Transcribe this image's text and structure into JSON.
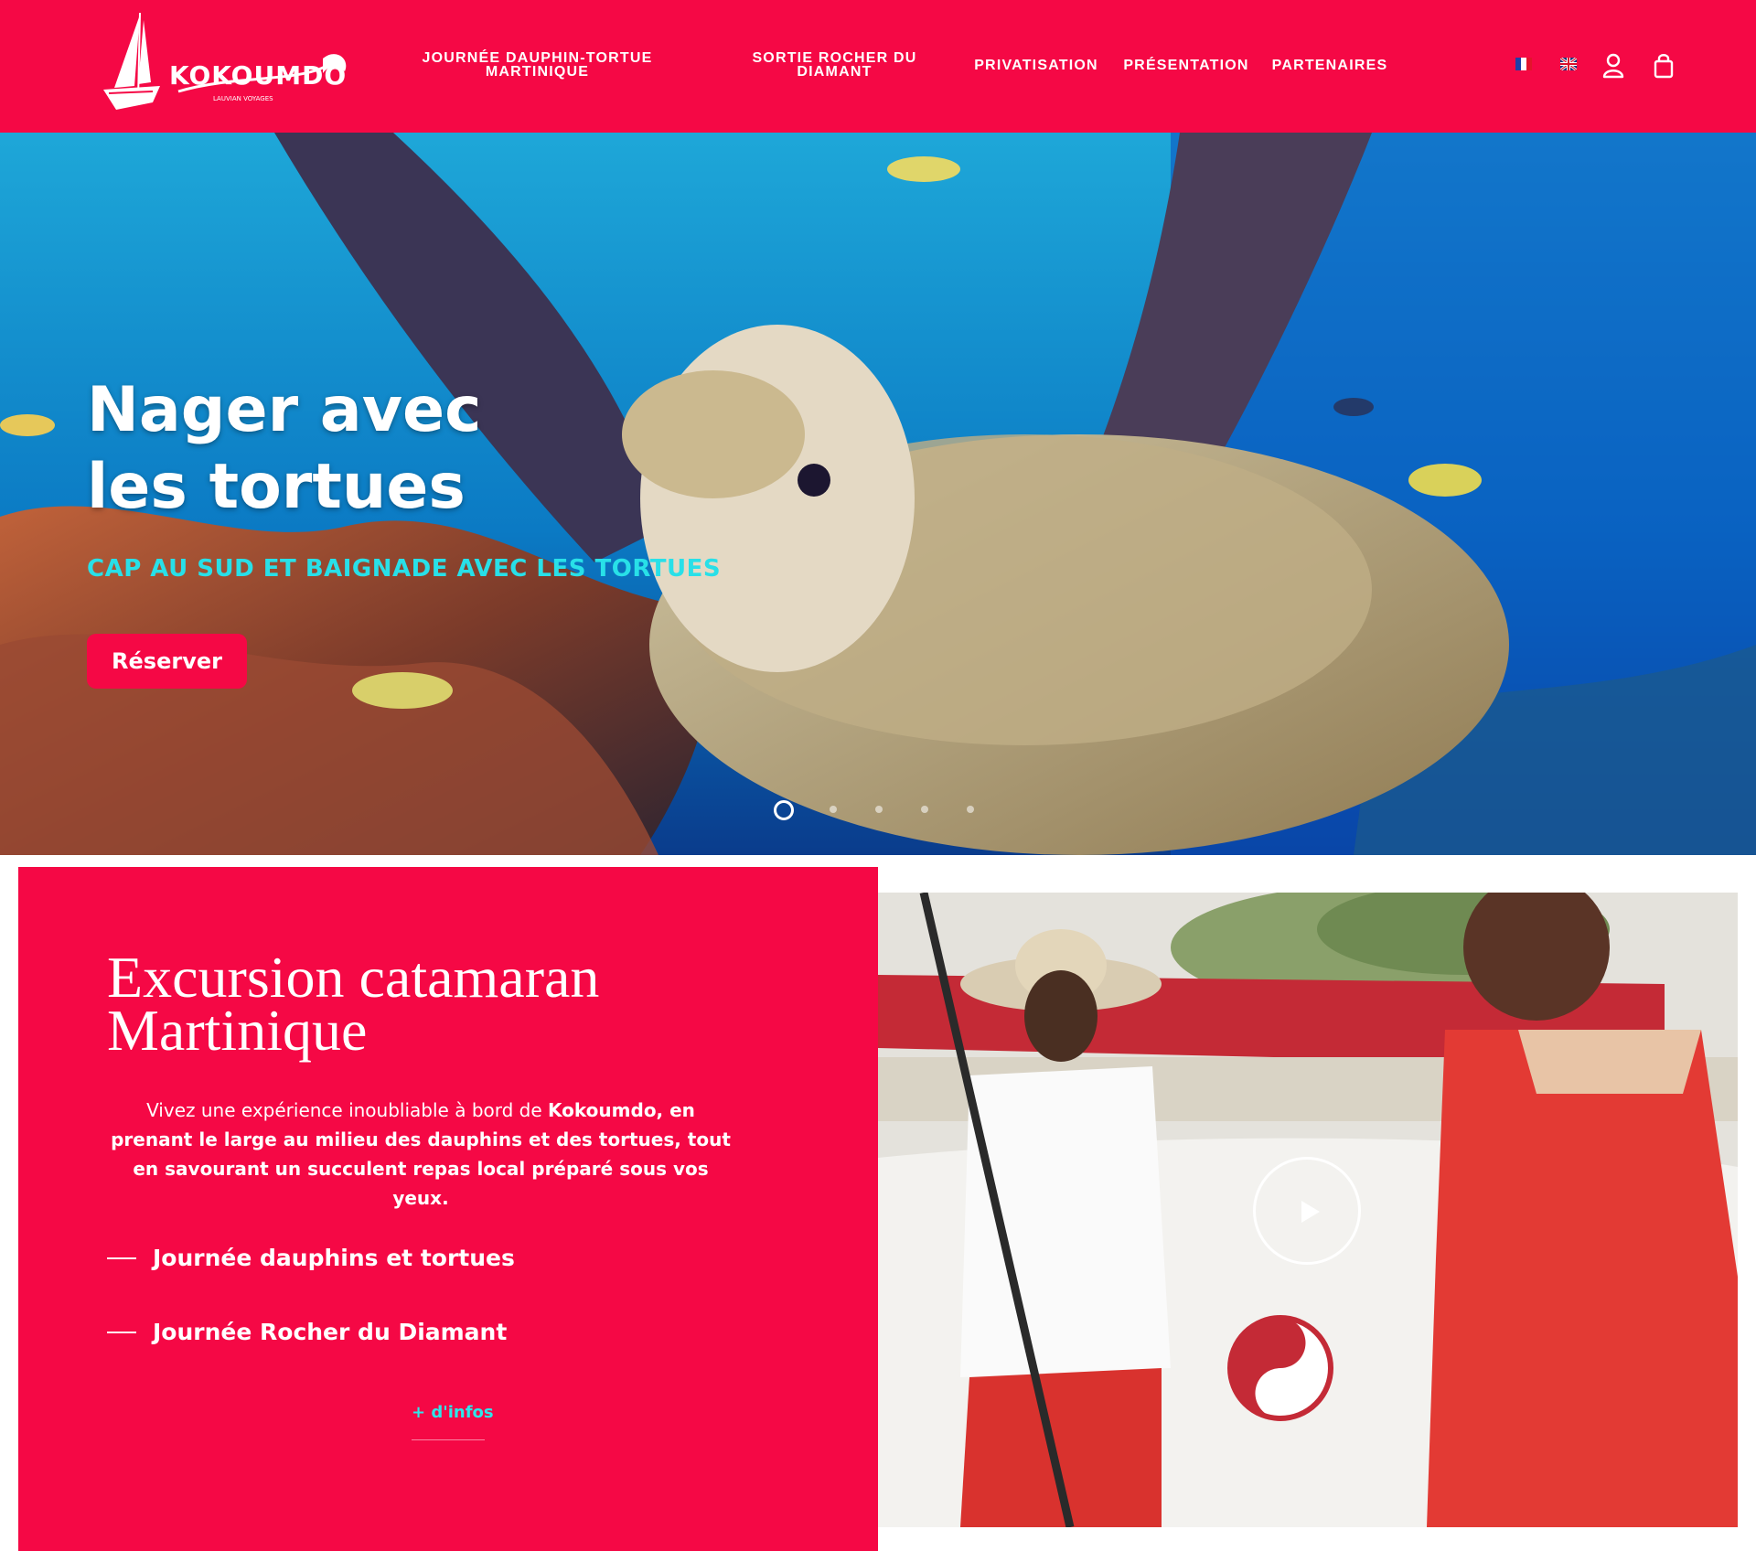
{
  "header": {
    "logo_text": "KOKOUMDO",
    "logo_tagline": "LAUVIAN VOYAGES",
    "nav": [
      {
        "line1": "JOURNÉE DAUPHIN-TORTUE",
        "line2": "MARTINIQUE"
      },
      {
        "line1": "SORTIE ROCHER DU",
        "line2": "DIAMANT"
      },
      {
        "label": "PRIVATISATION"
      },
      {
        "label": "PRÉSENTATION"
      },
      {
        "label": "PARTENAIRES"
      }
    ],
    "icons": [
      "flag-fr-icon",
      "flag-en-icon",
      "user-icon",
      "shopping-bag-icon"
    ],
    "colors": {
      "brand": "#f50845",
      "accent": "#2ee6ea"
    }
  },
  "hero": {
    "title_line1": "Nager avec",
    "title_line2": "les tortues",
    "subtitle": "CAP AU SUD ET BAIGNADE AVEC LES TORTUES",
    "button": "Réserver",
    "slides_total": 5,
    "active_slide": 1
  },
  "promo": {
    "title_line1": "Excursion catamaran",
    "title_line2": "Martinique",
    "text_prefix": "Vivez une expérience inoubliable à bord de ",
    "text_bold": "Kokoumdo, en prenant le large au milieu des dauphins et des tortues, tout en savourant un succulent repas local préparé sous vos yeux.",
    "links": [
      "Journée dauphins et tortues",
      "Journée Rocher du Diamant"
    ],
    "more": "+ d'infos"
  },
  "video": {
    "play_icon": "play-icon"
  }
}
